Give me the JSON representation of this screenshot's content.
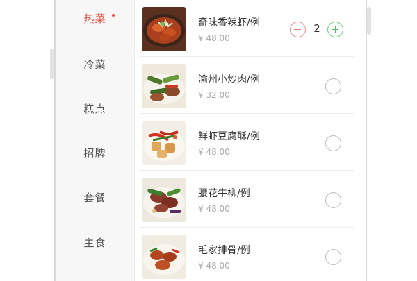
{
  "categories": [
    {
      "label": "热菜",
      "active": true
    },
    {
      "label": "冷菜",
      "active": false
    },
    {
      "label": "糕点",
      "active": false
    },
    {
      "label": "招牌",
      "active": false
    },
    {
      "label": "套餐",
      "active": false
    },
    {
      "label": "主食",
      "active": false
    }
  ],
  "dishes": [
    {
      "name": "奇味香辣虾/例",
      "price": "¥ 48.00",
      "quantity": "2"
    },
    {
      "name": "渝州小炒肉/例",
      "price": "¥ 32.00"
    },
    {
      "name": "鲜虾豆腐酥/例",
      "price": "¥ 48.00"
    },
    {
      "name": "腰花牛柳/例",
      "price": "¥ 48.00"
    },
    {
      "name": "毛家排骨/例",
      "price": "¥ 48.00"
    }
  ],
  "colors": {
    "accent": "#e64b3c",
    "minus": "#ee7777",
    "plus": "#50c062"
  },
  "icons": {
    "minus": "minus-circle-icon",
    "plus": "plus-circle-icon",
    "select": "empty-circle-icon",
    "new_badge": "red-dot-icon"
  }
}
